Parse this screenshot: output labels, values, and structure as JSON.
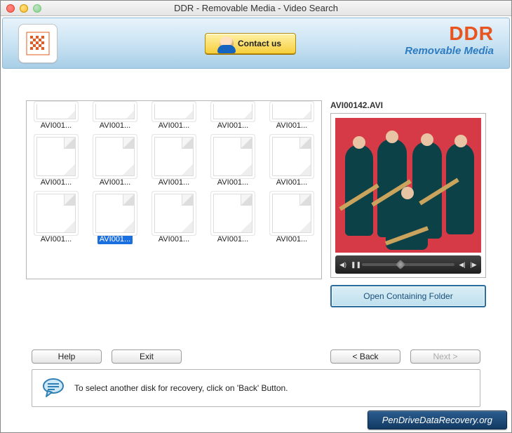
{
  "window": {
    "title": "DDR - Removable Media - Video Search"
  },
  "header": {
    "contact_label": "Contact us",
    "brand_top": "DDR",
    "brand_sub": "Removable Media"
  },
  "files": {
    "items": [
      {
        "label": "AVI001...",
        "partial": true
      },
      {
        "label": "AVI001...",
        "partial": true
      },
      {
        "label": "AVI001...",
        "partial": true
      },
      {
        "label": "AVI001...",
        "partial": true
      },
      {
        "label": "AVI001...",
        "partial": true
      },
      {
        "label": "AVI001..."
      },
      {
        "label": "AVI001..."
      },
      {
        "label": "AVI001..."
      },
      {
        "label": "AVI001..."
      },
      {
        "label": "AVI001..."
      },
      {
        "label": "AVI001..."
      },
      {
        "label": "AVI001...",
        "selected": true
      },
      {
        "label": "AVI001..."
      },
      {
        "label": "AVI001..."
      },
      {
        "label": "AVI001..."
      }
    ]
  },
  "preview": {
    "filename": "AVI00142.AVI",
    "open_folder_label": "Open Containing Folder"
  },
  "nav": {
    "help": "Help",
    "exit": "Exit",
    "back": "< Back",
    "next": "Next >"
  },
  "hint": {
    "text": "To select another disk for recovery, click on 'Back' Button."
  },
  "footer": {
    "badge": "PenDriveDataRecovery.org"
  }
}
